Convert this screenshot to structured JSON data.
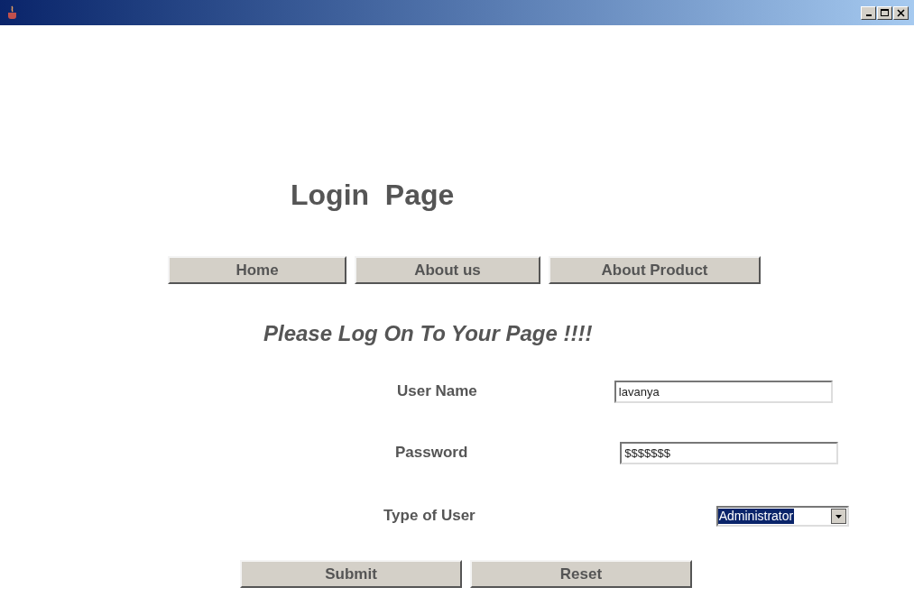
{
  "page_title": "Login  Page",
  "nav_buttons": [
    "Home",
    "About us",
    "About Product"
  ],
  "heading": "Please Log On To Your Page !!!!",
  "fields": [
    {
      "kind": "text",
      "label": "User Name",
      "value": "lavanya"
    },
    {
      "kind": "text",
      "label": "Password",
      "value": "$$$$$$$"
    },
    {
      "kind": "dropdown",
      "label": "Type of User",
      "value": "Administrator"
    }
  ],
  "buttons": [
    "Submit",
    "Reset"
  ]
}
